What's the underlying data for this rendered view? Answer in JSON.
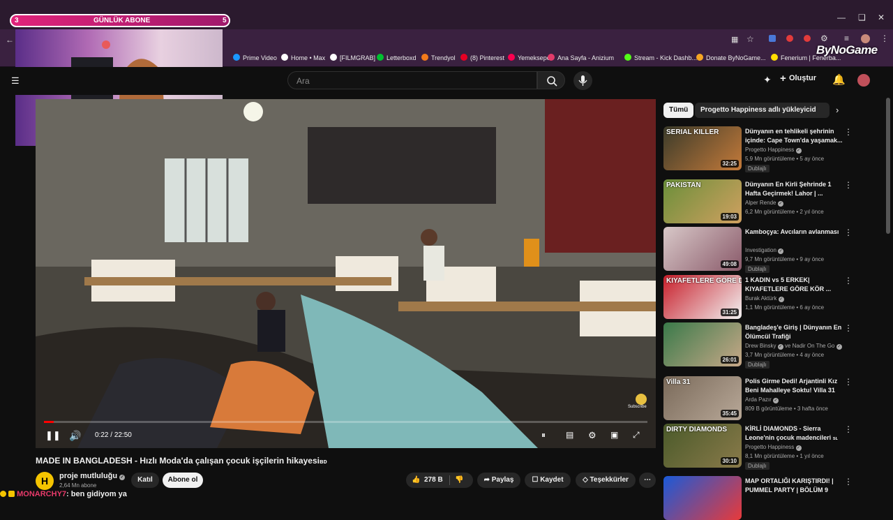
{
  "overlay": {
    "left_num": "3",
    "label": "GÜNLÜK ABONE",
    "right_num": "5",
    "brand": "ByNoGame"
  },
  "bookmarks": [
    {
      "label": "Prime Video",
      "color": "#1a98ff"
    },
    {
      "label": "Home • Max",
      "color": "#ffffff"
    },
    {
      "label": "[FILMGRAB]",
      "color": "#ffffff"
    },
    {
      "label": "Letterboxd",
      "color": "#00c030"
    },
    {
      "label": "Trendyol",
      "color": "#f27a1a"
    },
    {
      "label": "(8) Pinterest",
      "color": "#e60023"
    },
    {
      "label": "Yemeksepeti",
      "color": "#fa0050"
    },
    {
      "label": "Ana Sayfa - Anizium",
      "color": "#e23b6a"
    },
    {
      "label": "Stream - Kick Dashb...",
      "color": "#53fc18"
    },
    {
      "label": "Donate ByNoGame...",
      "color": "#f5a623"
    },
    {
      "label": "Fenerium | Fenerba...",
      "color": "#ffdd00"
    }
  ],
  "header": {
    "search_placeholder": "Ara",
    "create_label": "Oluştur"
  },
  "player": {
    "current_time": "0:22",
    "duration": "22:50",
    "progress": 0.016,
    "time_sep": "/",
    "watermark_label": "Subscribe"
  },
  "video": {
    "title": "MADE IN BANGLADESH - Hızlı Moda'da çalışan çocuk işçilerin hikayesi",
    "title_suffix": "ʙᴅ",
    "channel_name": "proje mutluluğu",
    "subscribers": "2,64 Mn abone",
    "join_label": "Katıl",
    "subscribe_label": "Abone ol",
    "likes": "278 B",
    "share_label": "Paylaş",
    "save_label": "Kaydet",
    "thanks_label": "Teşekkürler"
  },
  "chat": {
    "username": "MONARCHY7",
    "message": ": ben gidiyom ya"
  },
  "sidebar": {
    "chips": [
      "Tümü",
      "Progetto Happiness adlı yükleyiciden"
    ],
    "recommendations": [
      {
        "title": "Dünyanın en tehlikeli şehrinin içinde: Cape Town'da yaşamak...",
        "channel": "Progetto Happiness",
        "meta": "5,9 Mn görüntüleme • 5 ay önce",
        "duration": "32:25",
        "badge": "Dublajlı",
        "thumb_text": "SERIAL KILLER",
        "color1": "#3b3b2a",
        "color2": "#c47a3a"
      },
      {
        "title": "Dünyanın En Kirli Şehrinde 1 Hafta Geçirmek! Lahor | ...",
        "channel": "Alper Rende",
        "meta": "6,2 Mn görüntüleme • 2 yıl önce",
        "duration": "19:03",
        "badge": "",
        "thumb_text": "PAKISTAN",
        "color1": "#6b8f3a",
        "color2": "#d0a060"
      },
      {
        "title": "Kamboçya: Avcıların avlanması",
        "channel": "Investigation",
        "meta": "9,7 Mn görüntüleme • 9 ay önce",
        "duration": "49:08",
        "badge": "Dublajlı",
        "thumb_text": "",
        "color1": "#d8c8c8",
        "color2": "#8a5a6a"
      },
      {
        "title": "1 KADIN vs 5 ERKEK| KIYAFETLERE GÖRE KÖR ...",
        "channel": "Burak Aktürk",
        "meta": "1,1 Mn görüntüleme • 6 ay önce",
        "duration": "31:25",
        "badge": "",
        "thumb_text": "KIYAFETLERE GÖRE DATE",
        "color1": "#c81e2a",
        "color2": "#f2f2f2"
      },
      {
        "title": "Bangladeş'e Giriş | Dünyanın En Ölümcül Trafiği",
        "channel": "Drew Binsky",
        "channel_extra": "ve Nadir On The Go",
        "meta": "3,7 Mn görüntüleme • 4 ay önce",
        "duration": "26:01",
        "badge": "Dublajlı",
        "thumb_text": "",
        "color1": "#3a7a4a",
        "color2": "#c8a888"
      },
      {
        "title": "Polis Girme Dedi! Arjantinli Kız Beni Mahalleye Soktu! Villa 31",
        "channel": "Arda Pazır",
        "meta": "809 B görüntüleme • 3 hafta önce",
        "duration": "35:45",
        "badge": "",
        "thumb_text": "Villa 31",
        "color1": "#7a6a5a",
        "color2": "#b8a898"
      },
      {
        "title": "KİRLİ DIAMONDS - Sierra Leone'nin çocuk madencileri",
        "title_suffix": "sʟ",
        "channel": "Progetto Happiness",
        "meta": "8,1 Mn görüntüleme • 1 yıl önce",
        "duration": "30:10",
        "badge": "Dublajlı",
        "thumb_text": "DIRTY DIAMONDS",
        "color1": "#4a5a2a",
        "color2": "#8a7a4a"
      },
      {
        "title": "MAP ORTALIĞI KARIŞTIRDI! | PUMMEL PARTY | BÖLÜM 9",
        "channel": "",
        "meta": "",
        "duration": "",
        "badge": "",
        "thumb_text": "",
        "color1": "#1a5ad8",
        "color2": "#e83a3a"
      }
    ]
  }
}
